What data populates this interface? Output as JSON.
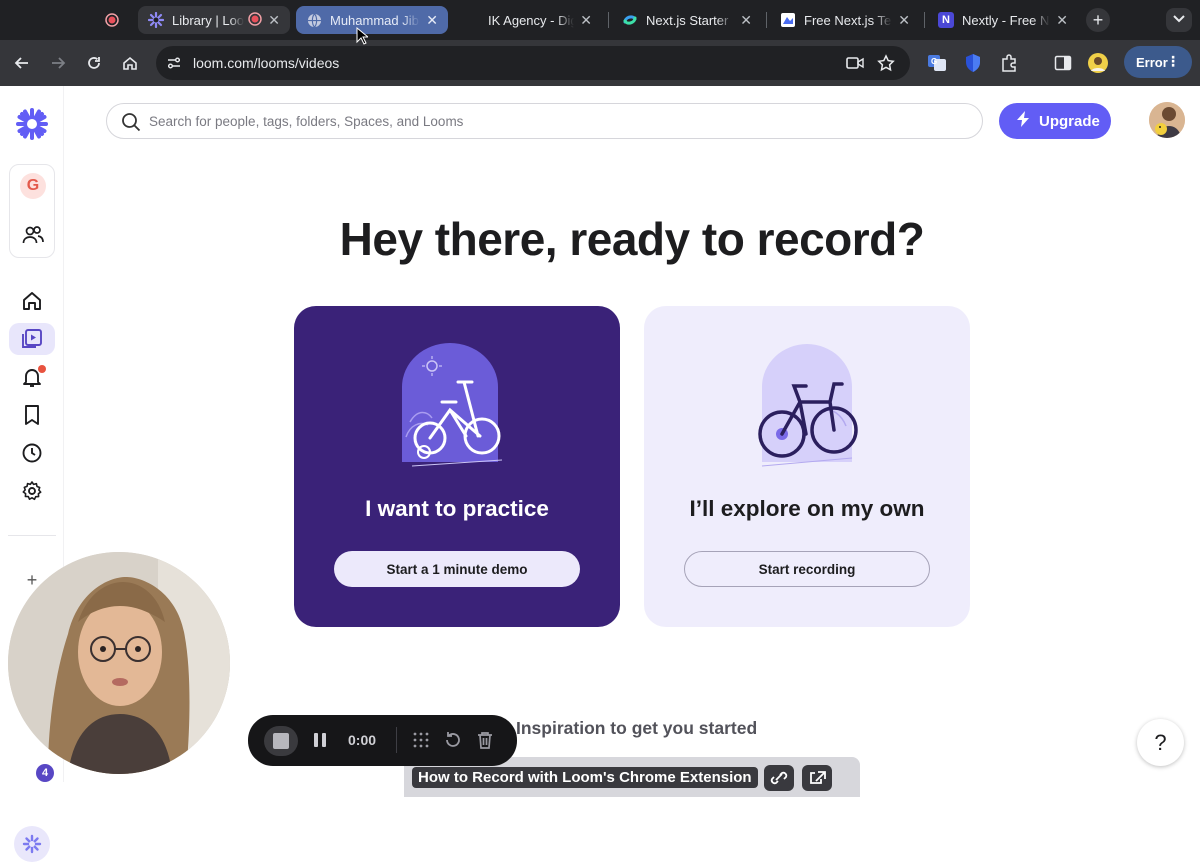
{
  "browser": {
    "tabs": [
      {
        "title": "",
        "icon": "recording-dot-icon"
      },
      {
        "title": "Library | Loom",
        "icon": "loom-logo-icon",
        "recording": true
      },
      {
        "title": "Muhammad Jibran",
        "icon": "globe-icon"
      },
      {
        "title": "IK Agency - Digital",
        "icon": "blank-icon"
      },
      {
        "title": "Next.js Starter",
        "icon": "swirl-icon"
      },
      {
        "title": "Free Next.js Templates",
        "icon": "template-icon"
      },
      {
        "title": "Nextly - Free Next.js",
        "icon": "n-logo-icon",
        "letter": "N"
      }
    ],
    "new_tab": "+",
    "url": "loom.com/looms/videos",
    "profile_button": "Error"
  },
  "app": {
    "workspace_initial": "G",
    "search_placeholder": "Search for people, tags, folders, Spaces, and Looms",
    "upgrade_label": "Upgrade",
    "hero_title": "Hey there, ready to record?",
    "cards": [
      {
        "title": "I want to practice",
        "button": "Start a 1 minute demo"
      },
      {
        "title": "I’ll explore on my own",
        "button": "Start recording"
      }
    ],
    "inspiration_title": "Inspiration to get you started",
    "video_title": "How to Record with Loom's Chrome Extension",
    "recorder": {
      "time": "0:00"
    },
    "help_label": "?",
    "notification_badge": "4",
    "add_label": "+",
    "colors": {
      "brand": "#625df5",
      "practice_card": "#3a2278",
      "explore_card": "#efedfc"
    }
  }
}
